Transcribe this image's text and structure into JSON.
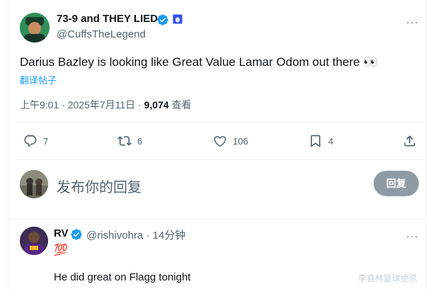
{
  "tweet": {
    "display_name": "73-9 and THEY LIED",
    "handle": "@CuffsTheLegend",
    "text": "Darius Bazley is looking like Great Value Lamar Odom out there 👀",
    "translate": "翻译帖子",
    "timestamp": "上午9:01 · 2025年7月11日 · ",
    "views_count": "9,074",
    "views_label": "查看",
    "more": "···"
  },
  "actions": {
    "replies": "7",
    "retweets": "6",
    "likes": "106",
    "bookmarks": "4"
  },
  "composer": {
    "placeholder": "发布你的回复",
    "button": "回复"
  },
  "reply": {
    "display_name": "RV",
    "handle": "@rishivohra",
    "time": "· 14分钟",
    "emoji": "💯",
    "text": "He did great on Flagg tonight",
    "more": "···"
  },
  "watermark": "李喜林篮球绝杀",
  "colors": {
    "accent": "#1d9bf0",
    "muted": "#536471",
    "button": "#8e9ba6",
    "verified": "#1d9bf0"
  },
  "icons": [
    "reply-icon",
    "retweet-icon",
    "like-icon",
    "bookmark-icon",
    "share-icon",
    "verified-icon",
    "affiliate-badge-icon",
    "more-icon"
  ]
}
